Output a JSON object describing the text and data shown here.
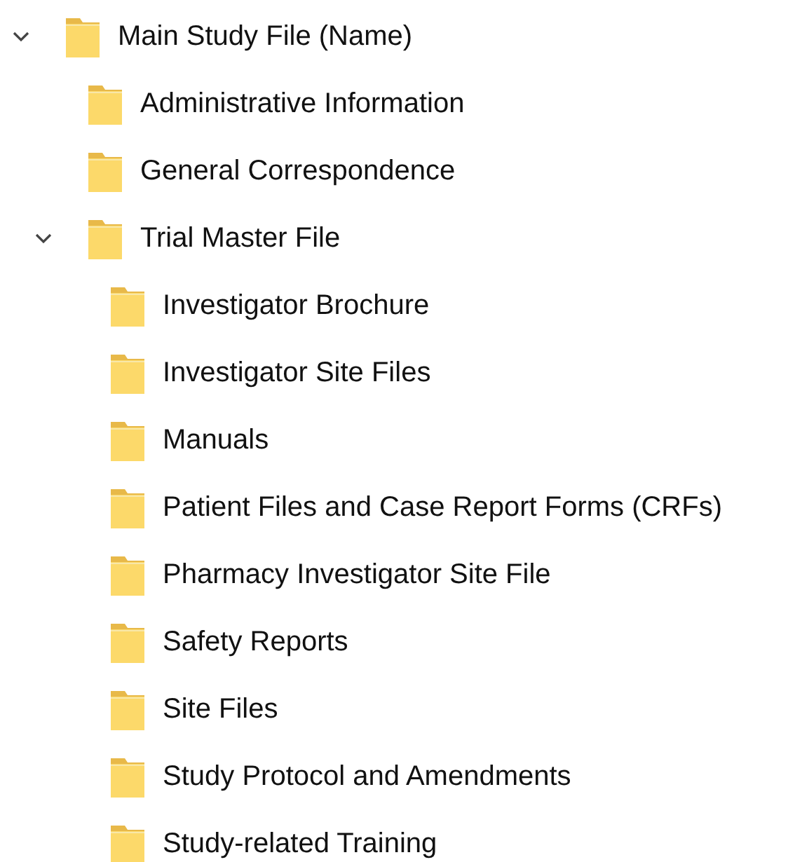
{
  "tree": [
    {
      "label": "Main Study File (Name)",
      "expanded": true,
      "children": [
        {
          "label": "Administrative Information"
        },
        {
          "label": "General Correspondence"
        },
        {
          "label": "Trial Master File",
          "expanded": true,
          "children": [
            {
              "label": "Investigator Brochure"
            },
            {
              "label": "Investigator Site Files"
            },
            {
              "label": "Manuals"
            },
            {
              "label": "Patient Files and Case Report Forms (CRFs)"
            },
            {
              "label": "Pharmacy Investigator Site File"
            },
            {
              "label": "Safety Reports"
            },
            {
              "label": "Site Files"
            },
            {
              "label": "Study Protocol and Amendments"
            },
            {
              "label": "Study-related Training"
            }
          ]
        }
      ]
    }
  ]
}
